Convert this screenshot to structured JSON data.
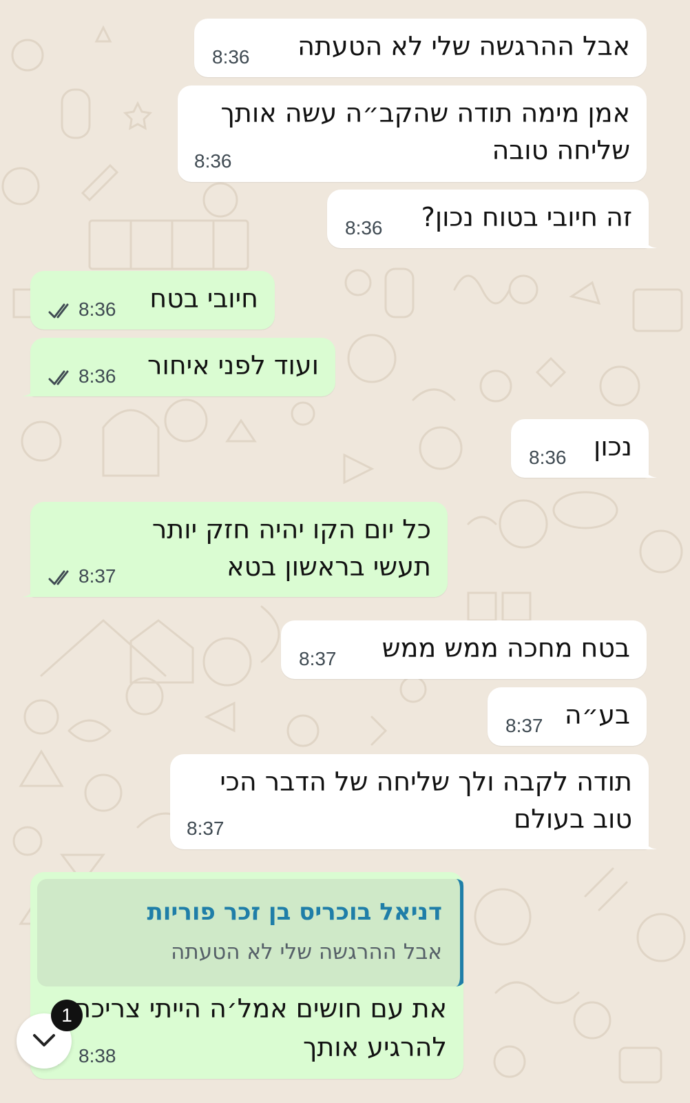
{
  "chat": {
    "messages": [
      {
        "dir": "in",
        "text_lines": [
          "אבל ההרגשה שלי לא הטעתה"
        ],
        "time": "8:36"
      },
      {
        "dir": "in",
        "text_lines": [
          "אמן מימה תודה שהקב״ה עשה אותך",
          "שליחה טובה"
        ],
        "time": "8:36"
      },
      {
        "dir": "in",
        "text_lines": [
          "זה חיובי בטוח נכון?"
        ],
        "time": "8:36"
      },
      {
        "dir": "out",
        "text_lines": [
          "חיובי בטח"
        ],
        "time": "8:36",
        "status": "read"
      },
      {
        "dir": "out",
        "text_lines": [
          "ועוד לפני איחור"
        ],
        "time": "8:36",
        "status": "read"
      },
      {
        "dir": "in",
        "text_lines": [
          "נכון"
        ],
        "time": "8:36"
      },
      {
        "dir": "out",
        "text_lines": [
          "כל יום הקו יהיה חזק יותר",
          "תעשי בראשון בטא"
        ],
        "time": "8:37",
        "status": "read"
      },
      {
        "dir": "in",
        "text_lines": [
          "בטח מחכה ממש ממש"
        ],
        "time": "8:37"
      },
      {
        "dir": "in",
        "text_lines": [
          "בע״ה"
        ],
        "time": "8:37"
      },
      {
        "dir": "in",
        "text_lines": [
          "תודה לקבה ולך שליחה של הדבר הכי",
          "טוב בעולם"
        ],
        "time": "8:37"
      },
      {
        "dir": "out",
        "reply_to": {
          "name": "דניאל בוכריס בן זכר פוריות",
          "text": "אבל ההרגשה שלי לא הטעתה"
        },
        "text_lines": [
          "את עם חושים אמל׳ה הייתי צריכה",
          "להרגיע אותך"
        ],
        "time": "8:38",
        "status": "read"
      }
    ]
  },
  "scroll_button": {
    "icon": "chevron-down-icon",
    "unread_count": "1"
  },
  "colors": {
    "background": "#efe7dc",
    "incoming_bubble": "#ffffff",
    "outgoing_bubble": "#dafcd2",
    "read_ticks": "#3f4a52",
    "quote_accent": "#1f7ea8"
  }
}
